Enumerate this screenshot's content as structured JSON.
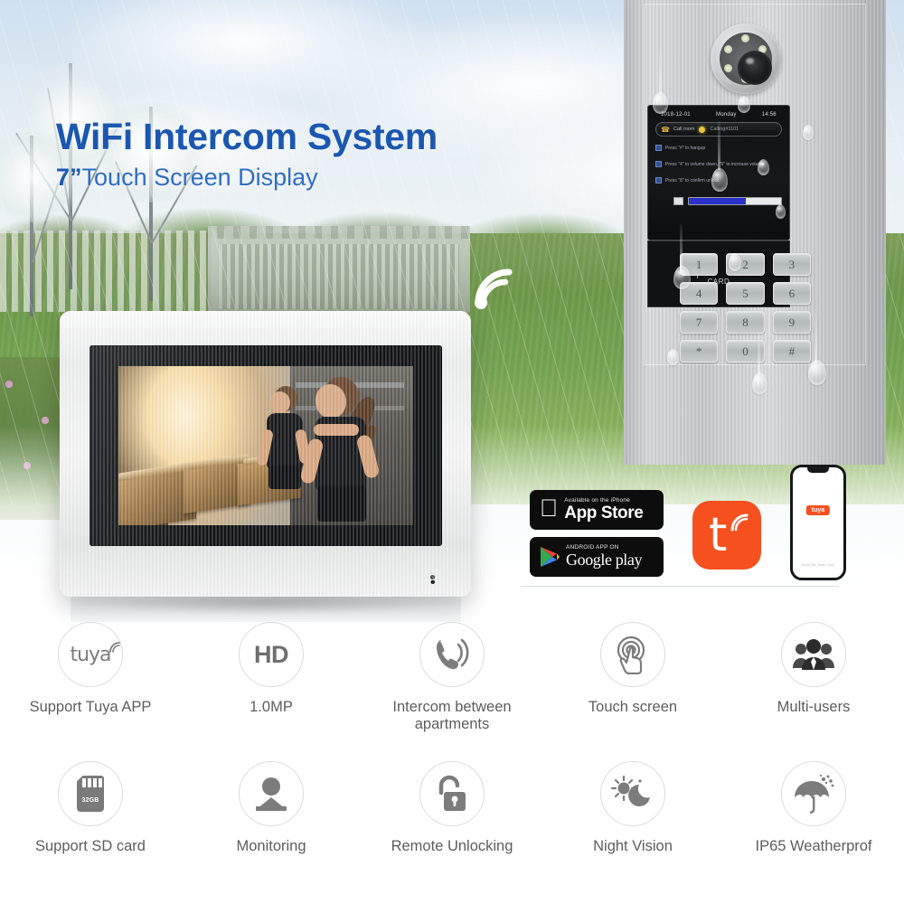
{
  "headline": {
    "title": "WiFi Intercom System",
    "subtitle_size": "7”",
    "subtitle_rest": "Touch Screen Display"
  },
  "wifi_badge": {
    "icon": "wifi-icon"
  },
  "indoor_monitor": {
    "name": "7-inch indoor touch monitor",
    "screen_scene": "gym interior with woman running on treadmill",
    "mic_indicator": "•"
  },
  "door_station": {
    "name": "outdoor door station",
    "camera": {
      "icon": "camera-lens-icon",
      "ir_led_count": 6
    },
    "lcd": {
      "date": "2018-12-01",
      "weekday": "Monday",
      "time": "14:56",
      "call_label": "Call room",
      "call_name": "Calling#1101",
      "hints": [
        "Press \"#\" to hangup",
        "Press \"4\" to volume down, \"6\" to increase volume",
        "Press \"8\" to confirm unlock"
      ],
      "volume_percent": 62
    },
    "card_reader_label": "CARD",
    "keypad": [
      "1",
      "2",
      "3",
      "4",
      "5",
      "6",
      "7",
      "8",
      "9",
      "*",
      "0",
      "#"
    ]
  },
  "apps": {
    "app_store": {
      "sub": "Available on the iPhone",
      "main": "App Store",
      "icon": "apple-icon"
    },
    "google_play": {
      "sub": "ANDROID APP ON",
      "main": "Google play",
      "icon": "google-play-icon"
    },
    "tuya_logo": {
      "label": "t",
      "color": "#f5501e",
      "icon": "tuya-icon"
    },
    "phone_mock": {
      "logo": "tuya",
      "footer": "Smart Life, Smart Living"
    }
  },
  "features": {
    "row1": [
      {
        "icon": "tuya-icon",
        "glyph": "tuya",
        "label": "Support Tuya APP"
      },
      {
        "icon": "hd-icon",
        "glyph": "HD",
        "label": "1.0MP"
      },
      {
        "icon": "phone-call-icon",
        "glyph": "☏",
        "label": "Intercom between apartments"
      },
      {
        "icon": "touch-screen-icon",
        "glyph": "☝",
        "label": "Touch screen"
      },
      {
        "icon": "multi-users-icon",
        "glyph": "👥",
        "label": "Multi-users"
      }
    ],
    "row2": [
      {
        "icon": "sd-card-icon",
        "glyph": "32GB",
        "label": "Support  SD card"
      },
      {
        "icon": "monitoring-person-icon",
        "glyph": "person",
        "label": "Monitoring"
      },
      {
        "icon": "unlock-icon",
        "glyph": "🔓",
        "label": "Remote Unlocking"
      },
      {
        "icon": "night-vision-icon",
        "glyph": "sun-moon",
        "label": "Night Vision"
      },
      {
        "icon": "umbrella-icon",
        "glyph": "☂",
        "label": "IP65 Weatherprof"
      }
    ]
  },
  "colors": {
    "headline_blue": "#1b57b0",
    "subtitle_blue": "#2f6dc4",
    "tuya_orange": "#f5501e",
    "feature_gray": "#5d5d5d",
    "lcd_blue_bar": "#2b31c8"
  }
}
